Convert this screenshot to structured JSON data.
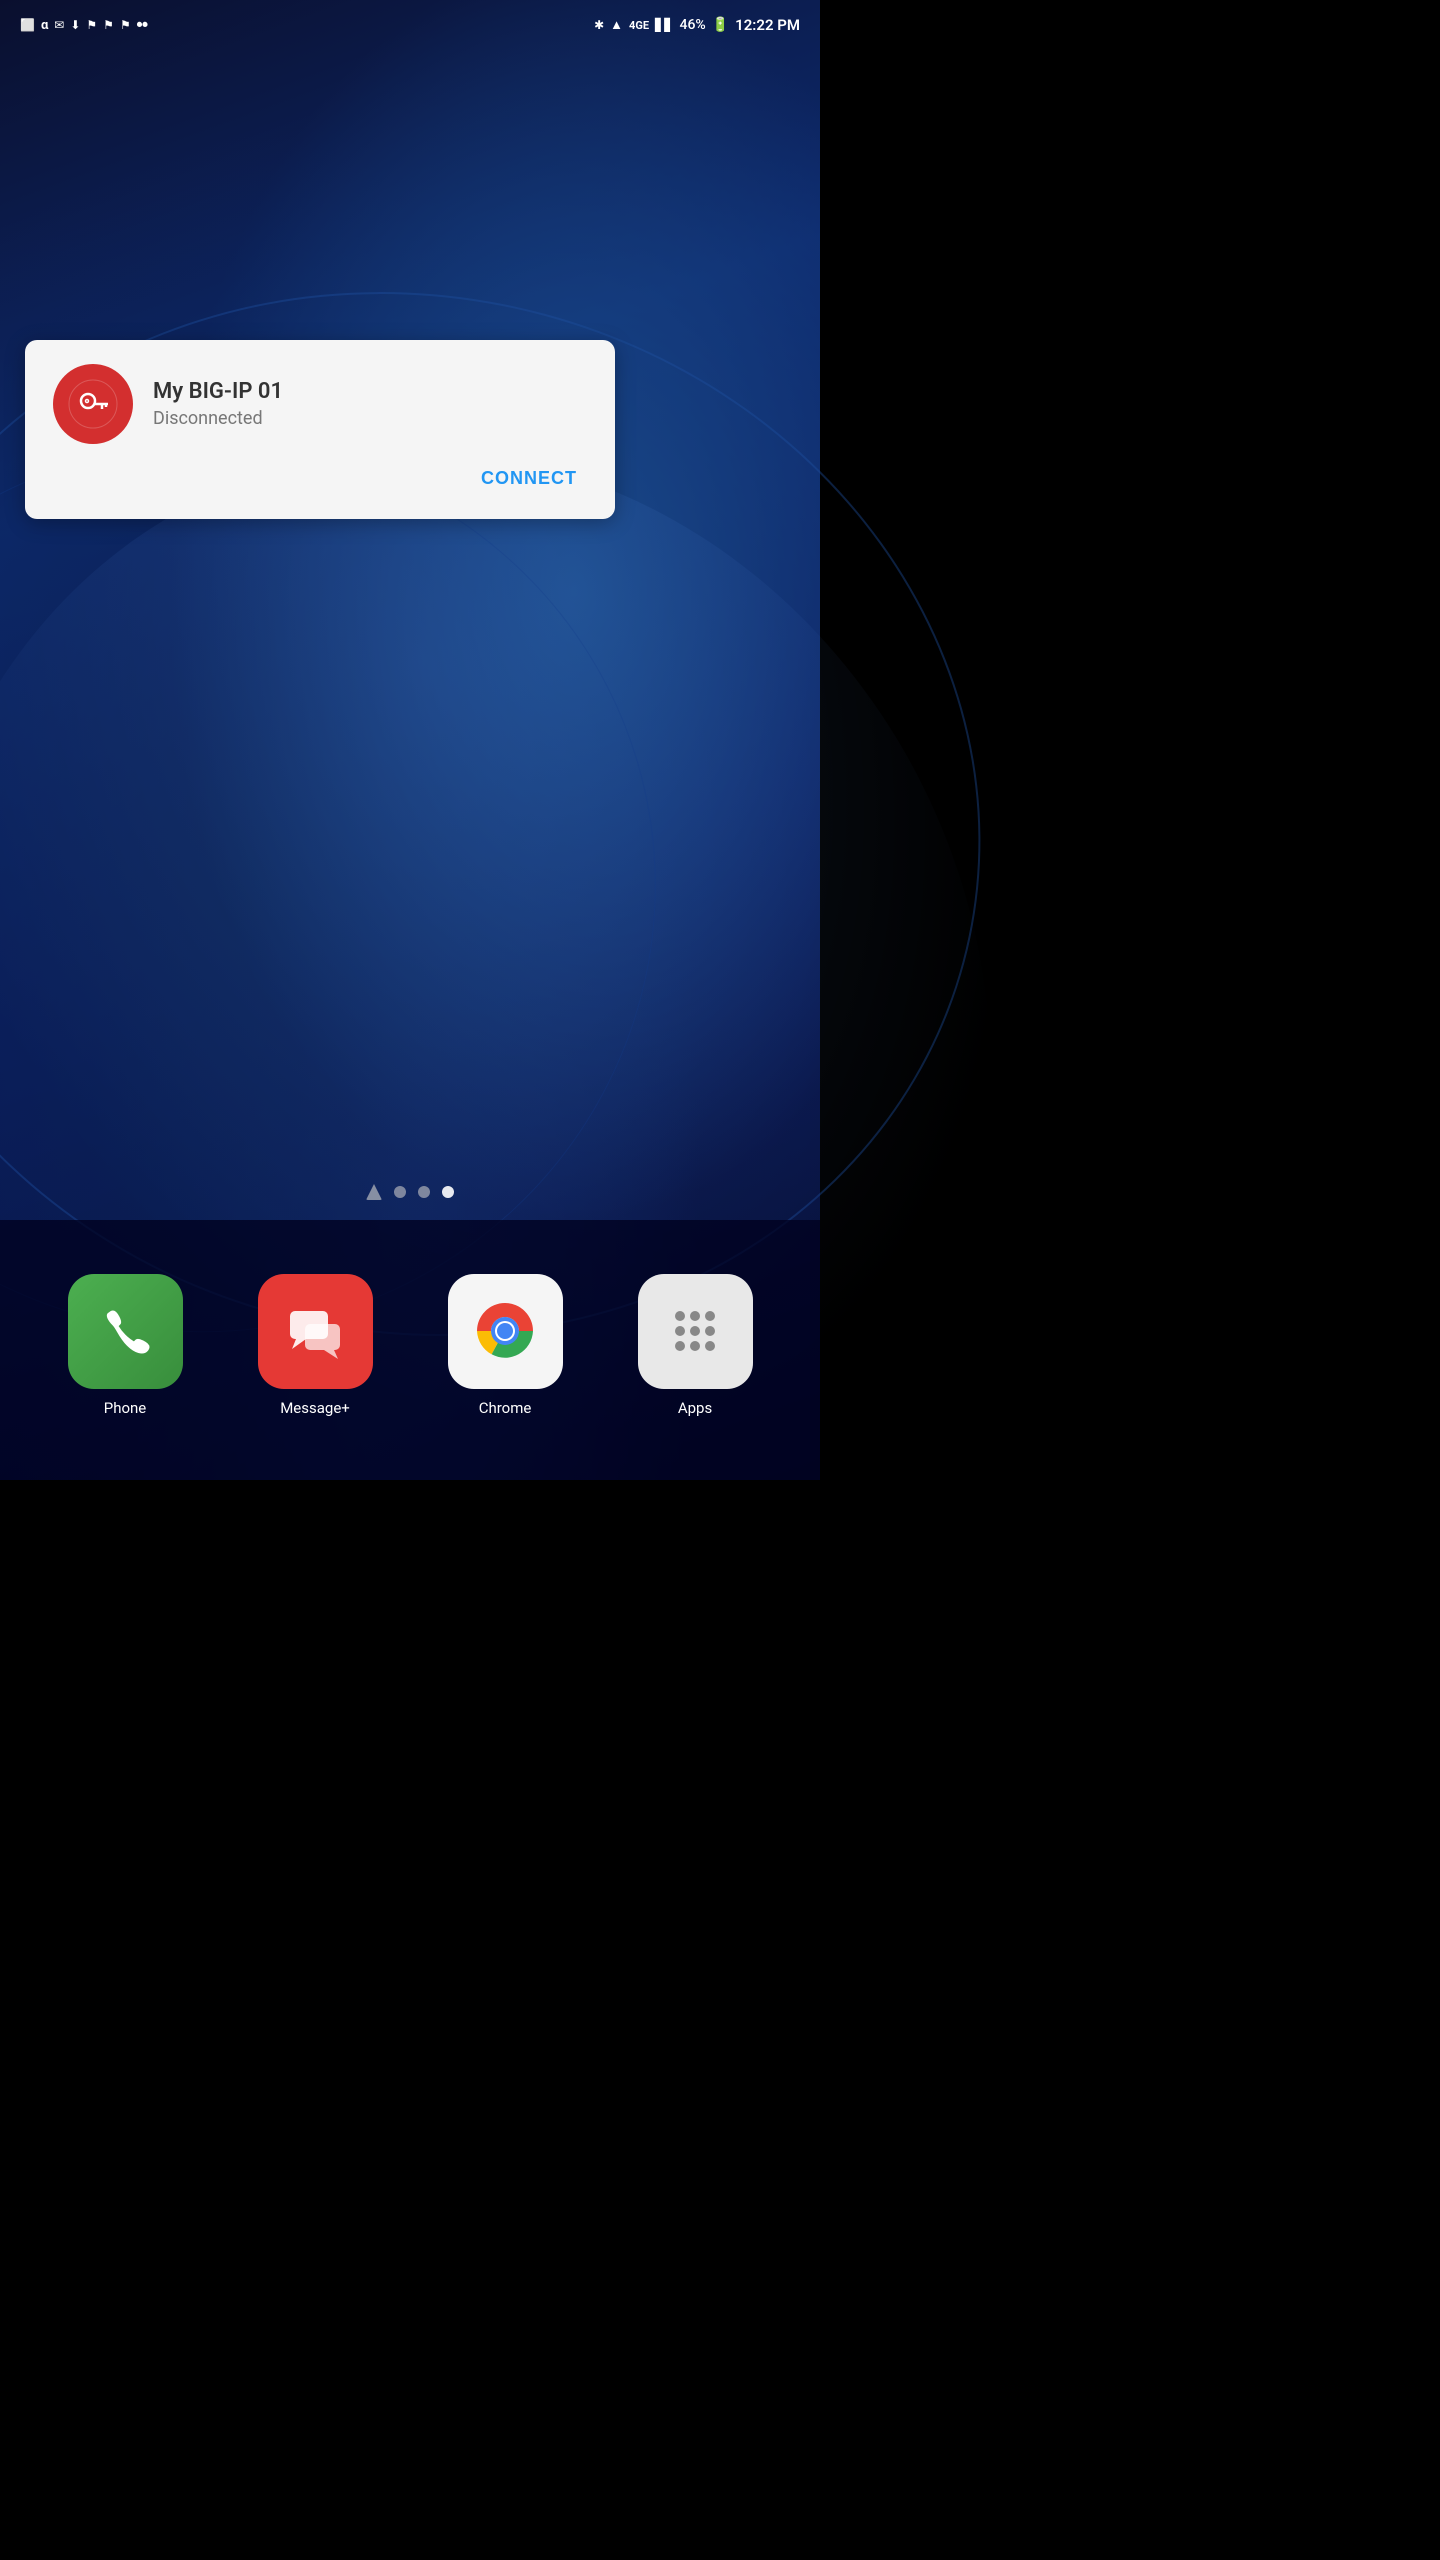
{
  "status_bar": {
    "time": "12:22 PM",
    "battery": "46%",
    "network": "4G",
    "left_icons": [
      "⬜",
      "α",
      "✉",
      "⬇",
      "⬛",
      "⬛",
      "⬛",
      "📞"
    ]
  },
  "notification": {
    "app_name": "My BIG-IP 01",
    "status": "Disconnected",
    "connect_label": "CONNECT"
  },
  "dock": {
    "items": [
      {
        "label": "Phone",
        "icon": "phone"
      },
      {
        "label": "Message+",
        "icon": "message"
      },
      {
        "label": "Chrome",
        "icon": "chrome"
      },
      {
        "label": "Apps",
        "icon": "apps"
      }
    ]
  },
  "page_indicators": {
    "count": 4,
    "active_index": 3
  }
}
